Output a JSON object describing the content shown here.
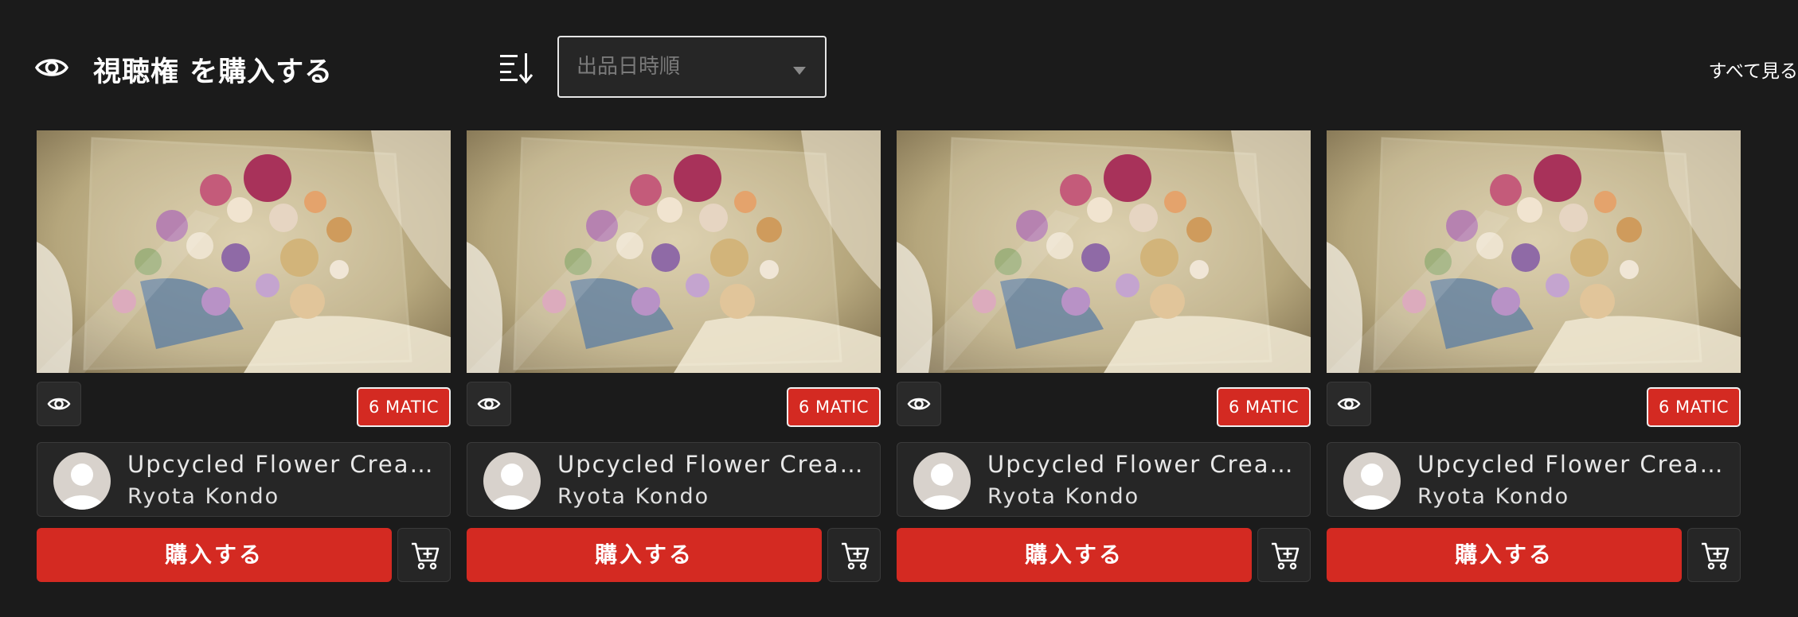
{
  "header": {
    "title": "視聴権 を購入する",
    "title_icon": "eye-icon",
    "sort_icon": "sort-icon",
    "sort_select": {
      "value": "出品日時順",
      "caret": "chevron-down-icon"
    },
    "see_all": "すべて見る"
  },
  "colors": {
    "background": "#1b1b1b",
    "accent": "#d42a22",
    "card_bg": "#262626"
  },
  "cards": [
    {
      "price": "6 MATIC",
      "title": "Upcycled Flower Creati...",
      "artist": "Ryota Kondo",
      "buy_label": "購入する",
      "thumbnail": "pressed-flower-arrangement",
      "view_icon": "eye-icon",
      "cart_icon": "cart-plus-icon",
      "avatar": "default-user-avatar"
    },
    {
      "price": "6 MATIC",
      "title": "Upcycled Flower Creati...",
      "artist": "Ryota Kondo",
      "buy_label": "購入する",
      "thumbnail": "pressed-flower-arrangement",
      "view_icon": "eye-icon",
      "cart_icon": "cart-plus-icon",
      "avatar": "default-user-avatar"
    },
    {
      "price": "6 MATIC",
      "title": "Upcycled Flower Creati...",
      "artist": "Ryota Kondo",
      "buy_label": "購入する",
      "thumbnail": "pressed-flower-arrangement",
      "view_icon": "eye-icon",
      "cart_icon": "cart-plus-icon",
      "avatar": "default-user-avatar"
    },
    {
      "price": "6 MATIC",
      "title": "Upcycled Flower Creati...",
      "artist": "Ryota Kondo",
      "buy_label": "購入する",
      "thumbnail": "pressed-flower-arrangement",
      "view_icon": "eye-icon",
      "cart_icon": "cart-plus-icon",
      "avatar": "default-user-avatar"
    }
  ]
}
